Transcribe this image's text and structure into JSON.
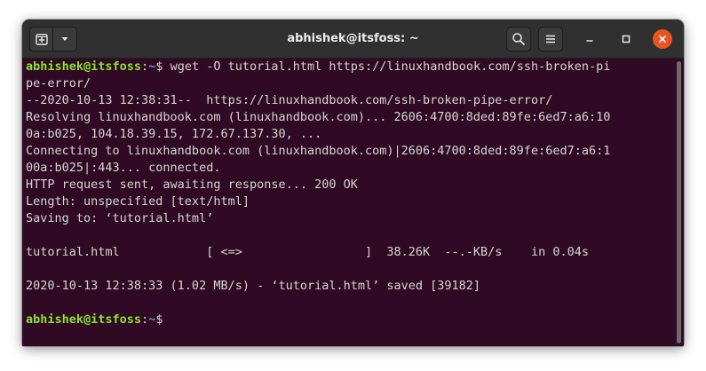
{
  "window": {
    "title": "abhishek@itsfoss: ~"
  },
  "toolbar": {
    "new_tab_icon": "new-tab-icon",
    "menu_dropdown_icon": "chevron-down-icon",
    "search_icon": "search-icon",
    "hamburger_icon": "hamburger-menu-icon",
    "minimize_icon": "minimize-icon",
    "maximize_icon": "maximize-icon",
    "close_icon": "close-icon"
  },
  "colors": {
    "terminal_bg": "#300a24",
    "prompt_user": "#8ae234",
    "prompt_path": "#729fcf",
    "text": "#d3d7cf",
    "close_button": "#e95420"
  },
  "terminal": {
    "prompt_user": "abhishek@itsfoss",
    "prompt_sep": ":",
    "prompt_path": "~",
    "prompt_symbol": "$",
    "command_line1": " wget -O tutorial.html https://linuxhandbook.com/ssh-broken-pi",
    "output": [
      "pe-error/",
      "--2020-10-13 12:38:31--  https://linuxhandbook.com/ssh-broken-pipe-error/",
      "Resolving linuxhandbook.com (linuxhandbook.com)... 2606:4700:8ded:89fe:6ed7:a6:10",
      "0a:b025, 104.18.39.15, 172.67.137.30, ...",
      "Connecting to linuxhandbook.com (linuxhandbook.com)|2606:4700:8ded:89fe:6ed7:a6:1",
      "00a:b025|:443... connected.",
      "HTTP request sent, awaiting response... 200 OK",
      "Length: unspecified [text/html]",
      "Saving to: ‘tutorial.html’",
      "",
      "tutorial.html            [ <=>                 ]  38.26K  --.-KB/s    in 0.04s",
      "",
      "2020-10-13 12:38:33 (1.02 MB/s) - ‘tutorial.html’ saved [39182]",
      ""
    ],
    "final_prompt_user": "abhishek@itsfoss",
    "final_prompt_sep": ":",
    "final_prompt_path": "~",
    "final_prompt_symbol": "$"
  }
}
